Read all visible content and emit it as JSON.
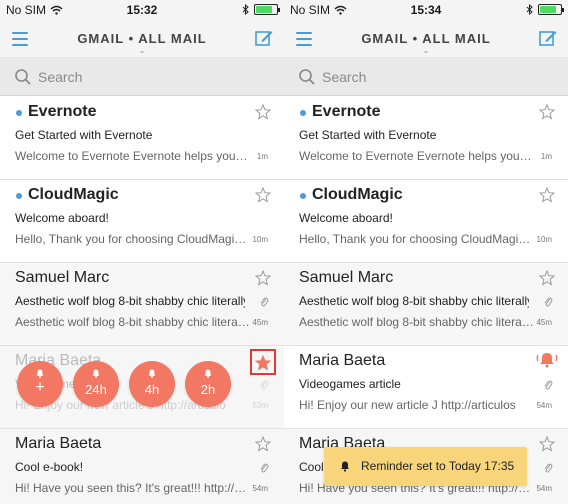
{
  "colors": {
    "accent": "#4a9bd6",
    "swipe_action": "#f37864",
    "star_highlight": "#e23a31",
    "toast_bg": "#f8d57a",
    "battery": "#4cd964"
  },
  "screens": [
    {
      "status": {
        "carrier": "No SIM",
        "time": "15:32"
      },
      "nav": {
        "title": "GMAIL • ALL MAIL",
        "chevron": "⌄",
        "menu_icon": "hamburger-icon",
        "compose_icon": "compose-icon"
      },
      "search": {
        "placeholder": "Search",
        "icon": "search-icon"
      },
      "emails": [
        {
          "sender": "Evernote",
          "subject": "Get Started with Evernote",
          "preview": "Welcome to Evernote Evernote helps you remember everything",
          "time": "1m",
          "unread": true,
          "starred": false,
          "attachment": false
        },
        {
          "sender": "CloudMagic",
          "subject": "Welcome aboard!",
          "preview": "Hello, Thank you for choosing CloudMagic as your email app",
          "time": "10m",
          "unread": true,
          "starred": false,
          "attachment": false
        },
        {
          "sender": "Samuel Marc",
          "subject": "Aesthetic wolf blog 8-bit shabby chic literally",
          "preview": "Aesthetic wolf blog 8-bit shabby chic literally vinyl",
          "time": "45m",
          "unread": false,
          "starred": false,
          "attachment": true
        },
        {
          "sender": "Maria Baeta",
          "subject": "Videogames article",
          "preview": "Hi! Enjoy our new article J http://articulo",
          "time": "53m",
          "unread": false,
          "starred": true,
          "attachment": true
        },
        {
          "sender": "Maria Baeta",
          "subject": "Cool e-book!",
          "preview": "Hi! Have you seen this? It's great!!! http://www",
          "time": "54m",
          "unread": false,
          "starred": false,
          "attachment": true
        }
      ],
      "snooze_actions": [
        {
          "label": "+",
          "icon": "bell-icon"
        },
        {
          "label": "24h",
          "icon": "bell-icon"
        },
        {
          "label": "4h",
          "icon": "bell-icon"
        },
        {
          "label": "2h",
          "icon": "bell-icon"
        }
      ]
    },
    {
      "status": {
        "carrier": "No SIM",
        "time": "15:34"
      },
      "nav": {
        "title": "GMAIL • ALL MAIL",
        "chevron": "⌄",
        "menu_icon": "hamburger-icon",
        "compose_icon": "compose-icon"
      },
      "search": {
        "placeholder": "Search",
        "icon": "search-icon"
      },
      "emails": [
        {
          "sender": "Evernote",
          "subject": "Get Started with Evernote",
          "preview": "Welcome to Evernote Evernote helps you remember everything",
          "time": "1m",
          "unread": true,
          "starred": false,
          "attachment": false
        },
        {
          "sender": "CloudMagic",
          "subject": "Welcome aboard!",
          "preview": "Hello, Thank you for choosing CloudMagic as your email app",
          "time": "10m",
          "unread": true,
          "starred": false,
          "attachment": false
        },
        {
          "sender": "Samuel Marc",
          "subject": "Aesthetic wolf blog 8-bit shabby chic literally",
          "preview": "Aesthetic wolf blog 8-bit shabby chic literally vinyl",
          "time": "45m",
          "unread": false,
          "starred": false,
          "attachment": true
        },
        {
          "sender": "Maria Baeta",
          "subject": "Videogames article",
          "preview": "Hi! Enjoy our new article J http://articulos",
          "time": "54m",
          "unread": false,
          "starred": false,
          "attachment": true,
          "reminder": true
        },
        {
          "sender": "Maria Baeta",
          "subject": "Cool e-book!",
          "preview": "Hi! Have you seen this? It's great!!! http://www",
          "time": "54m",
          "unread": false,
          "starred": false,
          "attachment": true
        }
      ],
      "toast": {
        "text": "Reminder set to Today 17:35",
        "icon": "bell-icon"
      }
    }
  ]
}
